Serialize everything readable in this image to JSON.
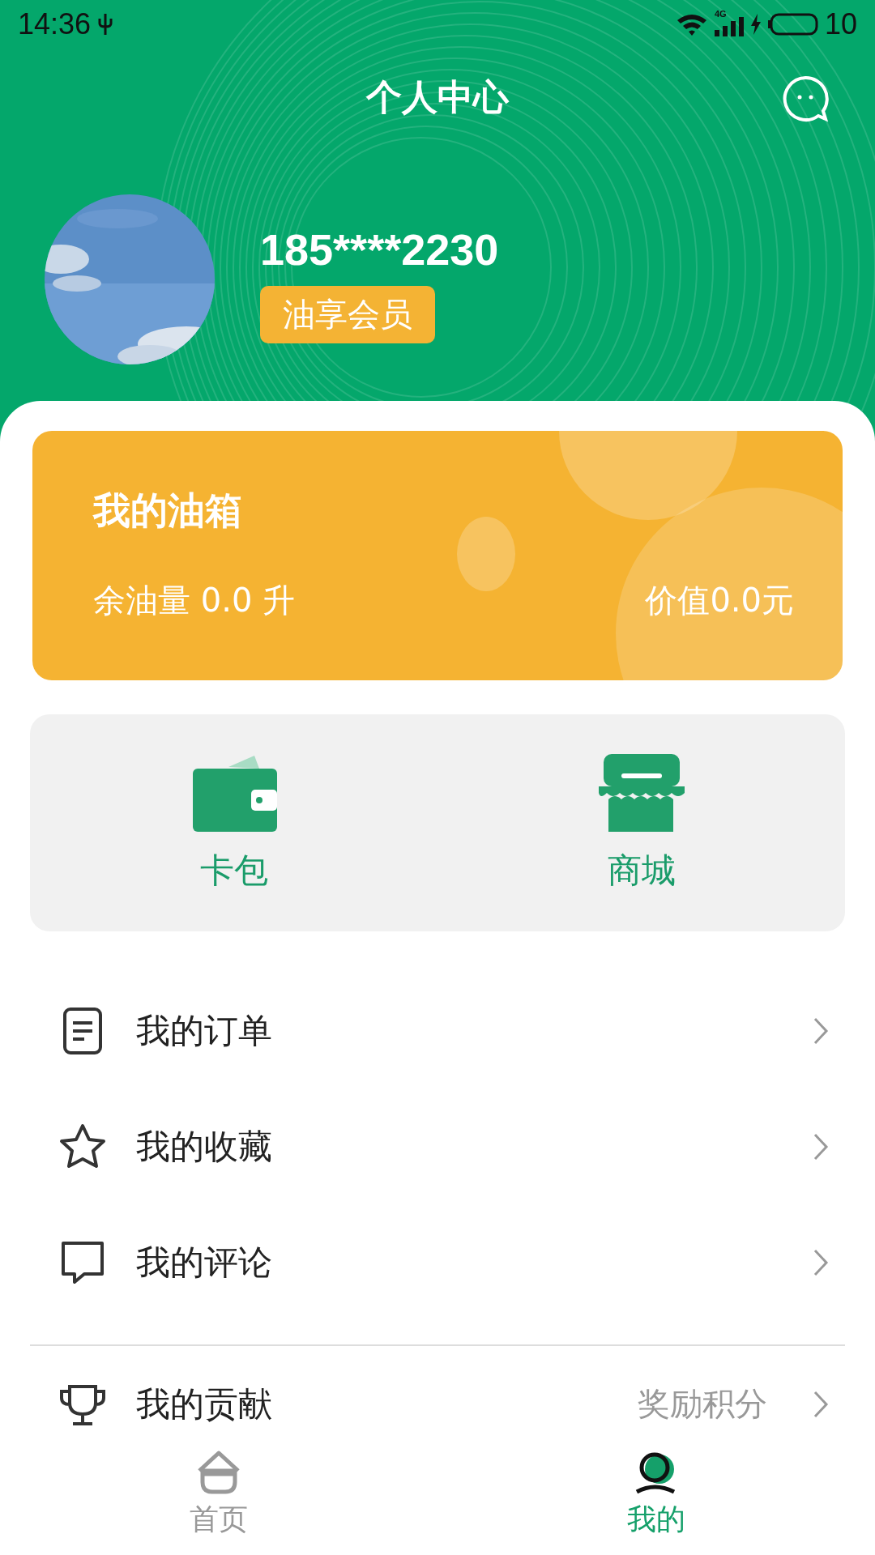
{
  "status_bar": {
    "time": "14:36",
    "network": "4G",
    "battery": "10"
  },
  "header": {
    "title": "个人中心"
  },
  "profile": {
    "phone": "185****2230",
    "member_badge": "油享会员"
  },
  "tank": {
    "title": "我的油箱",
    "remaining": "余油量 0.0 升",
    "value": "价值0.0元"
  },
  "shortcuts": [
    {
      "kind": "wallet",
      "label": "卡包"
    },
    {
      "kind": "store",
      "label": "商城"
    }
  ],
  "menu": [
    {
      "kind": "order",
      "label": "我的订单"
    },
    {
      "kind": "star",
      "label": "我的收藏"
    },
    {
      "kind": "comment",
      "label": "我的评论"
    }
  ],
  "menu_2": [
    {
      "kind": "trophy",
      "label": "我的贡献",
      "detail": "奖励积分"
    }
  ],
  "tab_bar": [
    {
      "kind": "home",
      "label": "首页",
      "selected": false
    },
    {
      "kind": "me",
      "label": "我的",
      "selected": true
    }
  ]
}
